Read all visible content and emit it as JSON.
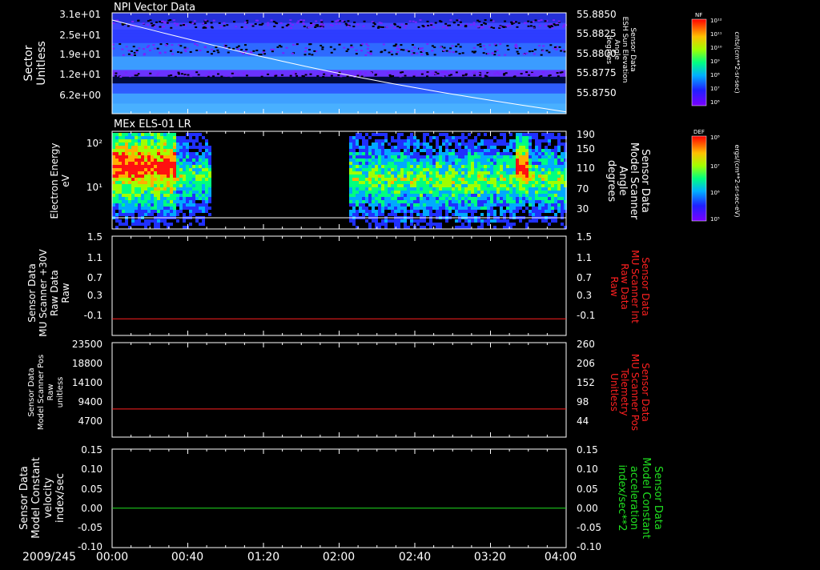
{
  "date_label": "2009/245",
  "time_ticks": [
    "00:00",
    "00:40",
    "01:20",
    "02:00",
    "02:40",
    "03:20",
    "04:00"
  ],
  "chart_data": [
    {
      "type": "heatmap",
      "title": "NPI Vector Data",
      "left_label": [
        "Sector",
        "Unitless"
      ],
      "left_ticks": [
        "3.1e+01",
        "2.5e+01",
        "1.9e+01",
        "1.2e+01",
        "6.2e+00"
      ],
      "right_label": [
        "Sensor Data",
        "ESH Sun Elevation",
        "Angle",
        "degrees"
      ],
      "right_ticks": [
        "55.8850",
        "55.8825",
        "55.8800",
        "55.8775",
        "55.8750"
      ],
      "right_range": [
        55.8738,
        55.885
      ],
      "line_series": {
        "x_hours": [
          0,
          4
        ],
        "y": [
          55.8842,
          55.874
        ],
        "color": "#ffffff"
      },
      "colorbar": {
        "label": "NF",
        "units": "cnts/(cm**2-sr-sec)",
        "ticks": [
          "10¹²",
          "10¹¹",
          "10¹⁰",
          "10⁹",
          "10⁸",
          "10⁷",
          "10⁶"
        ]
      }
    },
    {
      "type": "heatmap",
      "title": "MEx ELS-01 LR",
      "left_label": [
        "Electron Energy",
        "eV"
      ],
      "left_ticks": [
        "10²",
        "10¹"
      ],
      "right_label": [
        "Sensor Data",
        "Model Scanner",
        "Angle",
        "degrees"
      ],
      "right_ticks": [
        "190",
        "150",
        "110",
        "70",
        "30"
      ],
      "data_gap_hours": [
        0.83,
        2.08
      ],
      "colorbar": {
        "label": "DEF",
        "units": "ergs/(cm**2-sr-sec-eV)",
        "ticks": [
          "10⁸",
          "10⁷",
          "10⁶",
          "10⁵"
        ]
      }
    },
    {
      "type": "line",
      "left_label": [
        "Sensor Data",
        "MU Scanner +30V",
        "Raw Data",
        "Raw"
      ],
      "left_ticks": [
        "1.5",
        "1.1",
        "0.7",
        "0.3",
        "-0.1"
      ],
      "right_label": [
        "Sensor Data",
        "MU Scanner Int",
        "Raw Data",
        "Raw"
      ],
      "right_ticks": [
        "1.5",
        "1.1",
        "0.7",
        "0.3",
        "-0.1"
      ],
      "ylim": [
        -0.3,
        1.5
      ],
      "series": [
        {
          "x_hours": [
            0,
            4
          ],
          "y": [
            0.0,
            0.0
          ],
          "color": "#ff2020"
        }
      ]
    },
    {
      "type": "line",
      "left_label": [
        "Sensor Data",
        "Model Scanner Pos",
        "Raw",
        "unitless"
      ],
      "left_ticks": [
        "23500",
        "18800",
        "14100",
        "9400",
        "4700"
      ],
      "right_label": [
        "Sensor Data",
        "MU Scanner Pos",
        "Telemetry",
        "Unitless"
      ],
      "right_ticks": [
        "260",
        "206",
        "152",
        "98",
        "44"
      ],
      "ylim": [
        0,
        23500
      ],
      "series": [
        {
          "x_hours": [
            0,
            4
          ],
          "y": [
            7000,
            7000
          ],
          "color": "#ff2020"
        }
      ]
    },
    {
      "type": "line",
      "left_label": [
        "Sensor Data",
        "Model Constant",
        "velocity",
        "index/sec"
      ],
      "left_ticks": [
        "0.15",
        "0.10",
        "0.05",
        "0.00",
        "-0.05",
        "-0.10"
      ],
      "right_label": [
        "Sensor Data",
        "Model Constant",
        "acceleration",
        "index/sec**2"
      ],
      "right_ticks": [
        "0.15",
        "0.10",
        "0.05",
        "0.00",
        "-0.05",
        "-0.10"
      ],
      "ylim": [
        -0.1,
        0.15
      ],
      "series": [
        {
          "x_hours": [
            0,
            4
          ],
          "y": [
            0.0,
            0.0
          ],
          "color": "#20e020"
        }
      ]
    }
  ]
}
